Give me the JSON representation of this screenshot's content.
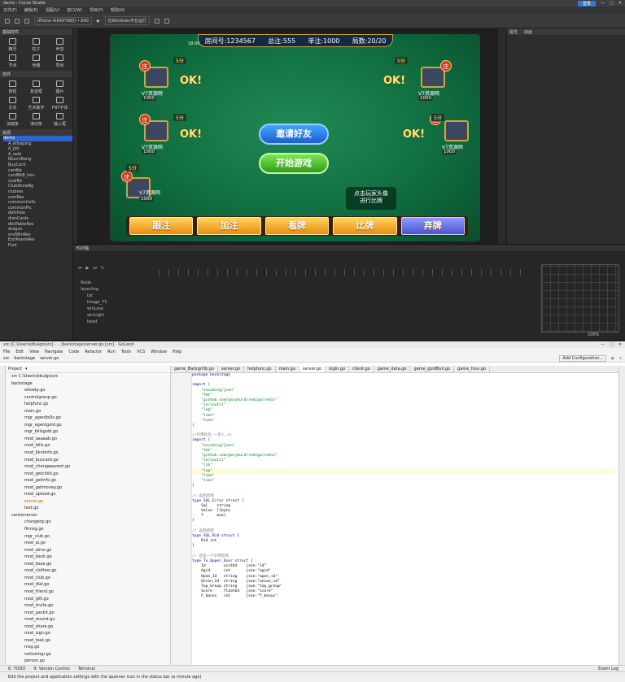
{
  "cocos": {
    "title": "demo - Cocos Studio",
    "account_button": "登录",
    "menus": [
      "文件(F)",
      "编辑(E)",
      "视图(V)",
      "窗口(W)",
      "项目(P)",
      "帮助(H)"
    ],
    "device": "iPhone 4(640*960) • 640",
    "platform": "在Windows平台运行",
    "widget_header": "基础控件",
    "widgets_basic": [
      "精灵",
      "粒子",
      "声音",
      "节点",
      "骨骼",
      "导出"
    ],
    "ctrl_header": "控件",
    "widgets_ctrl": [
      "按钮",
      "复选框",
      "图片",
      "文本",
      "艺术数字",
      "FNT字体",
      "加载条",
      "滑动条",
      "输入框"
    ],
    "resource_header": "资源",
    "tree": [
      "demo",
      "A_erbaping",
      "A_job",
      "A_web",
      "BeachBang",
      "BuyCard",
      "cardbk",
      "cardBkB_hen",
      "clubMc",
      "ClubShowBg",
      "clubres",
      "comRes",
      "commonCells",
      "commonPic",
      "defshow",
      "dianCards",
      "dbdTableRes",
      "dragon",
      "endWinRes",
      "ExitRoomRes",
      "Font"
    ],
    "right_tabs": [
      "属性",
      "动画"
    ],
    "timeline_tab": "时间轴",
    "timeline_rows": [
      "Node",
      "layer/ing",
      "txt",
      "Image_75",
      "winLose",
      "winLight",
      "head"
    ],
    "zoom": "100%",
    "game": {
      "room": "房间号:1234567",
      "total": "总注:555",
      "unit": "单注:1000",
      "round": "局数:20/20",
      "time": "18:00",
      "banker": "庄",
      "ok": "OK!",
      "seat_name": "V7资源网",
      "coin": "1000",
      "score": "5分",
      "invite": "邀请好友",
      "start": "开始游戏",
      "hint": "点击玩家头像\n进行比牌",
      "actions": [
        "跟注",
        "加注",
        "看牌",
        "比牌",
        "弃牌"
      ]
    }
  },
  "goland": {
    "title": "src [C:\\Users\\dbulgo\\src] - ...\\backstage\\server.go [src] - GoLand",
    "menus": [
      "File",
      "Edit",
      "View",
      "Navigate",
      "Code",
      "Refactor",
      "Run",
      "Tools",
      "VCS",
      "Window",
      "Help"
    ],
    "breadcrumb": [
      "src",
      "backstage",
      "server.go"
    ],
    "run_config": "Add Configuration...",
    "project_label": "Project",
    "root": "src C:\\Users\\dbulgo\\src",
    "tabs": [
      "game_BackgrDb.go",
      "server.go",
      "helpfunc.go",
      "main.go",
      "server.go",
      "login.go",
      "client.go",
      "game_data.go",
      "game_goldBull.go",
      "game_hisu.go"
    ],
    "backstage_folder": "backstage",
    "backstage_files": [
      "allowIp.go",
      "controlgroup.go",
      "helpfunc.go",
      "main.go",
      "mgr_agentbills.go",
      "mgr_agentgold.go",
      "mgr_billsgold.go",
      "mod_aaaaab.go",
      "mod_bills.go",
      "mod_bindinfo.go",
      "mod_buycard.go",
      "mod_changeparent.go",
      "mod_getchild.go",
      "mod_getinfo.go",
      "mod_getmoney.go",
      "mod_upload.go",
      "server.go",
      "test.go"
    ],
    "center_folder": "centerserver",
    "center_files": [
      "changeop.go",
      "fitmsg.go",
      "mgr_club.go",
      "mod_ai.go",
      "mod_alms.go",
      "mod_bank.go",
      "mod_base.go",
      "mod_clothes.go",
      "mod_club.go",
      "mod_dial.go",
      "mod_friend.go",
      "mod_gift.go",
      "mod_invite.go",
      "mod_packit.go",
      "mod_record.go",
      "mod_share.go",
      "mod_sign.go",
      "mod_task.go",
      "msg.go",
      "noticemgr.go",
      "person.go"
    ],
    "code": [
      "package backstage",
      "",
      "import (",
      "    \"encoding/json\"",
      "    \"fmt\"",
      "    \"github.com/garyburd/redigo/redis\"",
      "    \"io/ioutil\"",
      "    \"log\"",
      "    \"time\"",
      "    \"time\"",
      ")",
      "",
      "//引用的包 一定入 os",
      "import (",
      "    \"encoding/json\"",
      "    \"fmt\"",
      "    \"github.com/garyburd/redigo/redis\"",
      "    \"io/ioutil\"",
      "    \"lib\"",
      "    \"log\"",
      "    \"time\"",
      "    \"time\"",
      ")",
      "",
      "// 返回结构",
      "type SQL_Error struct {",
      "    Sql    string",
      "    Value  []byte",
      "    T      bool",
      "}",
      "",
      "// 返回结构",
      "type SQL_Rid struct {",
      "    Rid int",
      "}",
      "",
      "// 这是一个示例结构",
      "type To_Upper_User struct {",
      "    Id        uint64    json:\"id\"",
      "    Agid      int       json:\"agid\"",
      "    Open_Id   string    json:\"open_id\"",
      "    Union_Id  string    json:\"union_id\"",
      "    Top_Group string    json:\"top_group\"",
      "    Score     float64   json:\"score\"",
      "    F_bonus   int       json:\"f_bonus\""
    ],
    "bottom_tools": [
      "6: TODO",
      "9: Version Control",
      "Terminal"
    ],
    "event_log": "Event Log",
    "status": "Edit the project and application settings with the spanner icon in the status bar (a minute ago)",
    "left_strip": [
      "1: Project",
      "2: Structure",
      "2: Favorites"
    ],
    "right_strip": "Database"
  }
}
